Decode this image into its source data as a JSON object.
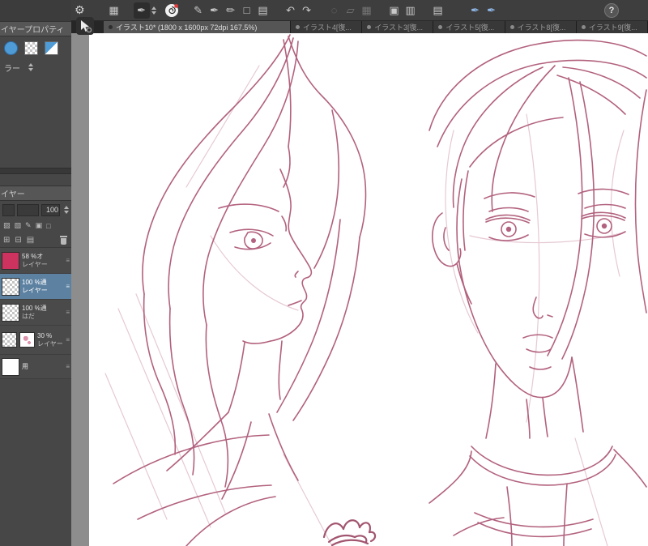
{
  "colors": {
    "line_art": "#b2617e",
    "line_art_dark": "#a25570",
    "line_art_light": "#e6c9d4",
    "accent_blue": "#4f9bd6",
    "swatch_pink": "#ce3360",
    "selected_layer_bg": "#5d81a1"
  },
  "toolbar": {
    "gear": "⚙",
    "help_label": "?",
    "icons": [
      {
        "name": "workspace-grid-icon",
        "glyph": "▦"
      },
      {
        "name": "current-tool-icon",
        "glyph": "✒"
      },
      {
        "name": "pencil-icon",
        "glyph": "✎"
      },
      {
        "name": "pen-icon",
        "glyph": "✒"
      },
      {
        "name": "marker-icon",
        "glyph": "✏"
      },
      {
        "name": "figure-icon",
        "glyph": "□"
      },
      {
        "name": "paper-icon",
        "glyph": "▤"
      },
      {
        "name": "undo-icon",
        "glyph": "↶"
      },
      {
        "name": "redo-icon",
        "glyph": "↷"
      },
      {
        "name": "lasso-icon",
        "glyph": "◌"
      },
      {
        "name": "transform-icon",
        "glyph": "▱"
      },
      {
        "name": "grid-icon",
        "glyph": "▦"
      },
      {
        "name": "select-area-icon",
        "glyph": "▣"
      },
      {
        "name": "deselect-icon",
        "glyph": "▥"
      },
      {
        "name": "ruler-icon",
        "glyph": "▤"
      },
      {
        "name": "tablet-pen-icon",
        "glyph": "✒"
      },
      {
        "name": "tablet-brush-icon",
        "glyph": "✒"
      }
    ]
  },
  "tabs": [
    {
      "label": "イラスト10* (1800 x 1600px 72dpi 167.5%)",
      "active": true
    },
    {
      "label": "イラスト4[復...",
      "active": false
    },
    {
      "label": "イラスト3[復...",
      "active": false
    },
    {
      "label": "イラスト5[復...",
      "active": false
    },
    {
      "label": "イラスト8[復...",
      "active": false
    },
    {
      "label": "イラスト9[復...",
      "active": false
    }
  ],
  "layer_property": {
    "title": "イヤープロパティ",
    "color_label": "ラー"
  },
  "layer_panel": {
    "title": "イヤー",
    "opacity": "100",
    "lock_icons": [
      "▨",
      "▧",
      "✎",
      "▣",
      "□"
    ],
    "action_icons": [
      "⊞",
      "⊟",
      "▤"
    ],
    "layers": [
      {
        "line1": "58 %オ",
        "line2": "レイヤー",
        "menu": "≡"
      },
      {
        "line1": "100 %通",
        "line2": "レイヤー",
        "menu": "≡"
      },
      {
        "line1": "100 %通",
        "line2": "はだ",
        "menu": "≡"
      },
      {
        "line1": "30 %",
        "line2": "レイヤー",
        "menu": "≡"
      },
      {
        "line1": "用",
        "line2": "",
        "menu": "≡"
      }
    ]
  }
}
